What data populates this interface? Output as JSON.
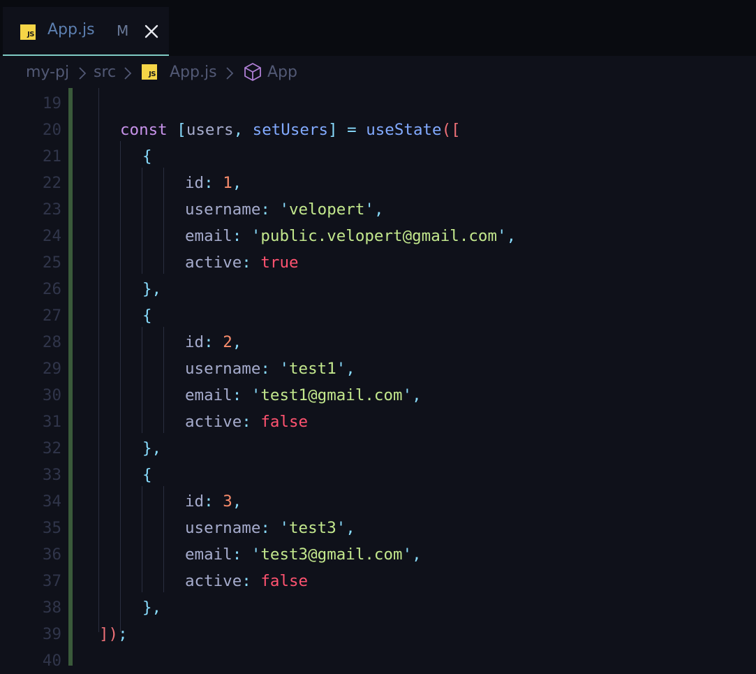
{
  "tab": {
    "filename": "App.js",
    "status": "M",
    "icon": "js-file-icon",
    "close_icon": "close-icon"
  },
  "js_badge_text": "JS",
  "breadcrumb": {
    "items": [
      "my-pj",
      "src",
      "App.js",
      "App"
    ],
    "icons": [
      "",
      "",
      "js-file-icon",
      "cube-icon"
    ]
  },
  "colors": {
    "background": "#0f111a",
    "tab_accent": "#80cbc4",
    "keyword": "#c792ea",
    "function": "#82aaff",
    "string": "#c3e88d",
    "number": "#f78c6c",
    "boolean": "#ff5370",
    "bracket": "#f07178",
    "punctuation": "#89ddff",
    "git_modified_bar": "#3a5a3a"
  },
  "editor": {
    "lines": [
      {
        "n": "19",
        "text": ""
      },
      {
        "n": "20",
        "text": "const [users, setUsers] = useState(["
      },
      {
        "n": "21",
        "text": "{"
      },
      {
        "n": "22",
        "text": "id: 1,"
      },
      {
        "n": "23",
        "text": "username: 'velopert',"
      },
      {
        "n": "24",
        "text": "email: 'public.velopert@gmail.com',"
      },
      {
        "n": "25",
        "text": "active: true"
      },
      {
        "n": "26",
        "text": "},"
      },
      {
        "n": "27",
        "text": "{"
      },
      {
        "n": "28",
        "text": "id: 2,"
      },
      {
        "n": "29",
        "text": "username: 'test1',"
      },
      {
        "n": "30",
        "text": "email: 'test1@gmail.com',"
      },
      {
        "n": "31",
        "text": "active: false"
      },
      {
        "n": "32",
        "text": "},"
      },
      {
        "n": "33",
        "text": "{"
      },
      {
        "n": "34",
        "text": "id: 3,"
      },
      {
        "n": "35",
        "text": "username: 'test3',"
      },
      {
        "n": "36",
        "text": "email: 'test3@gmail.com',"
      },
      {
        "n": "37",
        "text": "active: false"
      },
      {
        "n": "38",
        "text": "},"
      },
      {
        "n": "39",
        "text": "]);"
      },
      {
        "n": "40",
        "text": ""
      }
    ]
  }
}
